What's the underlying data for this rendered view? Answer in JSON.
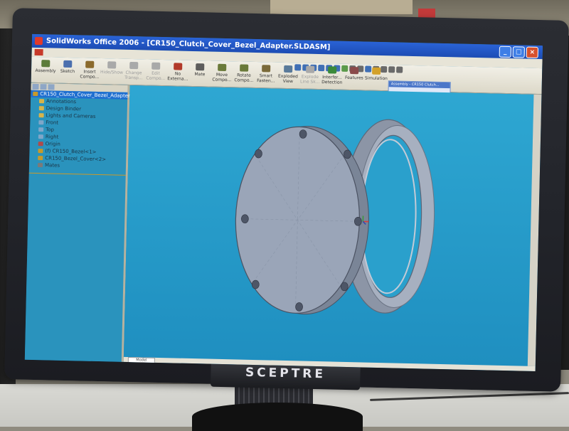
{
  "window": {
    "title": "SolidWorks Office 2006 - [CR150_Clutch_Cover_Bezel_Adapter.SLDASM]",
    "controls": [
      "_",
      "□",
      "×"
    ]
  },
  "toolbar": {
    "items": [
      {
        "label": "Assembly",
        "icon": "assembly-icon",
        "color": "#5c7c3a",
        "dim": false
      },
      {
        "label": "Sketch",
        "icon": "sketch-icon",
        "color": "#4b6fae",
        "dim": false
      },
      {
        "label": "Insert Compo...",
        "icon": "insert-component-icon",
        "color": "#8b6a2c",
        "dim": false
      },
      {
        "label": "Hide/Show",
        "icon": "hide-show-icon",
        "color": "#a9a9a9",
        "dim": true
      },
      {
        "label": "Change Transp...",
        "icon": "transparency-icon",
        "color": "#a9a9a9",
        "dim": true
      },
      {
        "label": "Edit Compo...",
        "icon": "edit-component-icon",
        "color": "#a9a9a9",
        "dim": true
      },
      {
        "label": "No Externa...",
        "icon": "no-external-icon",
        "color": "#b23a2a",
        "dim": false
      },
      {
        "label": "Mate",
        "icon": "mate-icon",
        "color": "#5d5d5d",
        "dim": false
      },
      {
        "label": "Move Compo...",
        "icon": "move-component-icon",
        "color": "#6a7a3a",
        "dim": false
      },
      {
        "label": "Rotate Compo...",
        "icon": "rotate-component-icon",
        "color": "#6a7a3a",
        "dim": false
      },
      {
        "label": "Smart Fasten...",
        "icon": "smart-fastener-icon",
        "color": "#7a6a3a",
        "dim": false
      },
      {
        "label": "Exploded View",
        "icon": "exploded-view-icon",
        "color": "#5a7a9a",
        "dim": false
      },
      {
        "label": "Explode Line Sk...",
        "icon": "explode-line-icon",
        "color": "#a9a9a9",
        "dim": true
      },
      {
        "label": "Interfer... Detection",
        "icon": "interference-icon",
        "color": "#3a8a3a",
        "dim": false
      },
      {
        "label": "Features",
        "icon": "features-icon",
        "color": "#8a4a4a",
        "dim": false
      },
      {
        "label": "Simulation",
        "icon": "simulation-icon",
        "color": "#d3a12a",
        "dim": false
      }
    ],
    "search_panel_title": "Assembly - CR150 Clutch..."
  },
  "tree": {
    "items": [
      {
        "label": "CR150_Clutch_Cover_Bezel_Adapter",
        "indent": 0,
        "icon_color": "#c79a2a",
        "selected": true
      },
      {
        "label": "Annotations",
        "indent": 1,
        "icon_color": "#d8b44a",
        "selected": false
      },
      {
        "label": "Design Binder",
        "indent": 1,
        "icon_color": "#d8b44a",
        "selected": false
      },
      {
        "label": "Lights and Cameras",
        "indent": 1,
        "icon_color": "#d8b44a",
        "selected": false
      },
      {
        "label": "Front",
        "indent": 1,
        "icon_color": "#7fa6c8",
        "selected": false
      },
      {
        "label": "Top",
        "indent": 1,
        "icon_color": "#7fa6c8",
        "selected": false
      },
      {
        "label": "Right",
        "indent": 1,
        "icon_color": "#7fa6c8",
        "selected": false
      },
      {
        "label": "Origin",
        "indent": 1,
        "icon_color": "#b04a4a",
        "selected": false
      },
      {
        "label": "(f) CR150_Bezel<1>",
        "indent": 1,
        "icon_color": "#c79a2a",
        "selected": false
      },
      {
        "label": "CR150_Bezel_Cover<2>",
        "indent": 1,
        "icon_color": "#c79a2a",
        "selected": false
      },
      {
        "label": "Mates",
        "indent": 1,
        "icon_color": "#7a7a7a",
        "selected": false
      }
    ]
  },
  "statusbar": {
    "model_tab": "Model"
  },
  "monitor": {
    "brand": "SCEPTRE"
  },
  "colors": {
    "viewport": "#1f8fc0",
    "titlebar": "#2a63d6",
    "part": "#9aa5b8"
  }
}
